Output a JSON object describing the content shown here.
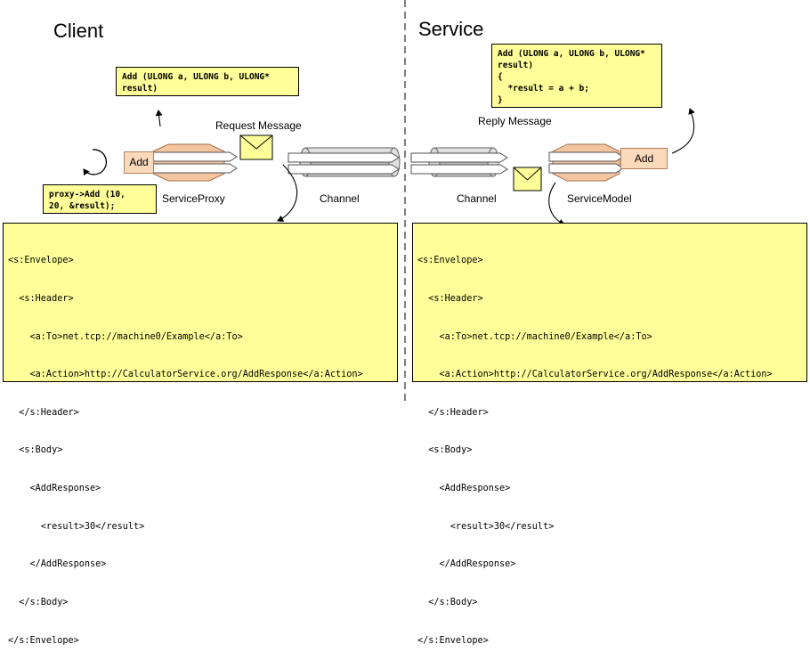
{
  "client": {
    "title": "Client",
    "add_box": "Add",
    "proxy_label": "ServiceProxy",
    "channel_label": "Channel",
    "request_label": "Request Message",
    "signature_note": "Add (ULONG a, ULONG b, ULONG*\nresult)",
    "call_note": "proxy->Add (10,\n20, &result);",
    "xml_lines": [
      "<s:Envelope>",
      "  <s:Header>",
      "    <a:To>net.tcp://machine0/Example</a:To>",
      "    <a:Action>http://CalculatorService.org/AddResponse</a:Action>",
      "  </s:Header>",
      "  <s:Body>",
      "    <AddResponse>",
      "      <result>30</result>",
      "    </AddResponse>",
      "  </s:Body>",
      "</s:Envelope>"
    ]
  },
  "service": {
    "title": "Service",
    "add_box": "Add",
    "model_label": "ServiceModel",
    "channel_label": "Channel",
    "reply_label": "Reply Message",
    "impl_note": "Add (ULONG a, ULONG b, ULONG*\nresult)\n{\n  *result = a + b;\n}",
    "xml_lines": [
      "<s:Envelope>",
      "  <s:Header>",
      "    <a:To>net.tcp://machine0/Example</a:To>",
      "    <a:Action>http://CalculatorService.org/AddResponse</a:Action>",
      "  </s:Header>",
      "  <s:Body>",
      "    <AddResponse>",
      "      <result>30</result>",
      "    </AddResponse>",
      "  </s:Body>",
      "</s:Envelope>"
    ]
  },
  "colors": {
    "note_fill": "#ffff99",
    "node_fill": "#fbd9bb",
    "octagon_fill": "#f5c5a0",
    "channel_fill": "#c8c8c8"
  }
}
